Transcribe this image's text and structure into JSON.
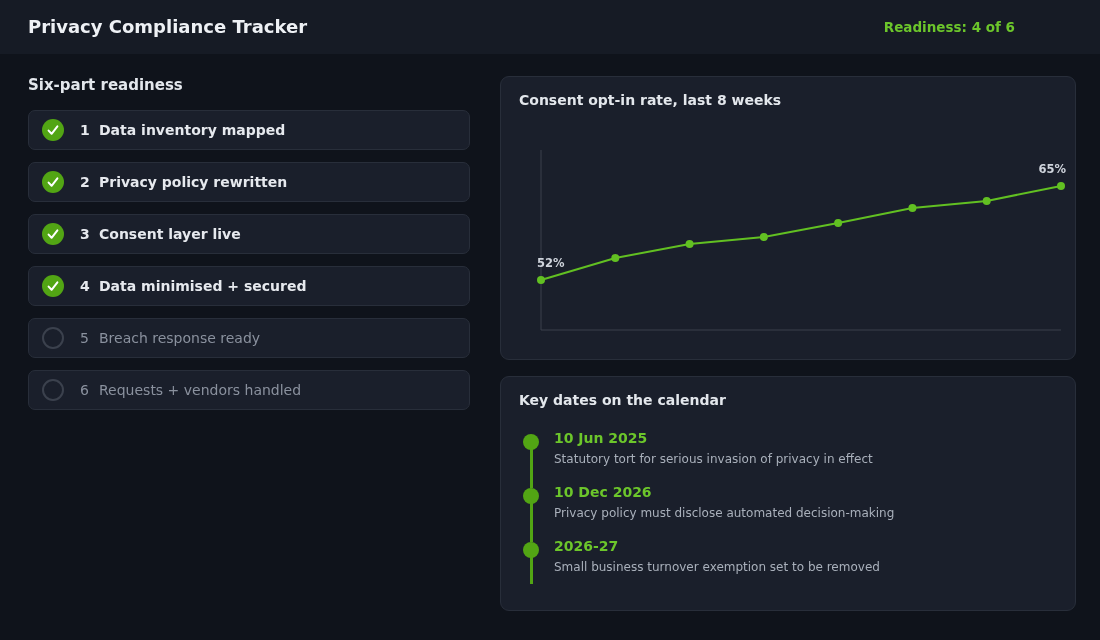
{
  "header": {
    "title": "Privacy Compliance Tracker",
    "readiness": "Readiness: 4 of 6"
  },
  "readiness": {
    "title": "Six-part readiness",
    "steps": [
      {
        "number": "1",
        "label": "Data inventory mapped",
        "done": true
      },
      {
        "number": "2",
        "label": "Privacy policy rewritten",
        "done": true
      },
      {
        "number": "3",
        "label": "Consent layer live",
        "done": true
      },
      {
        "number": "4",
        "label": "Data minimised + secured",
        "done": true
      },
      {
        "number": "5",
        "label": "Breach response ready",
        "done": false
      },
      {
        "number": "6",
        "label": "Requests + vendors handled",
        "done": false
      }
    ]
  },
  "consent_chart": {
    "title": "Consent opt-in rate, last 8 weeks",
    "start_label": "52%",
    "end_label": "65%"
  },
  "key_dates": {
    "title": "Key dates on the calendar",
    "events": [
      {
        "date": "10 Jun 2025",
        "description": "Statutory tort for serious invasion of privacy in effect"
      },
      {
        "date": "10 Dec 2026",
        "description": "Privacy policy must disclose automated decision-making"
      },
      {
        "date": "2026-27",
        "description": "Small business turnover exemption set to be removed"
      }
    ]
  }
}
